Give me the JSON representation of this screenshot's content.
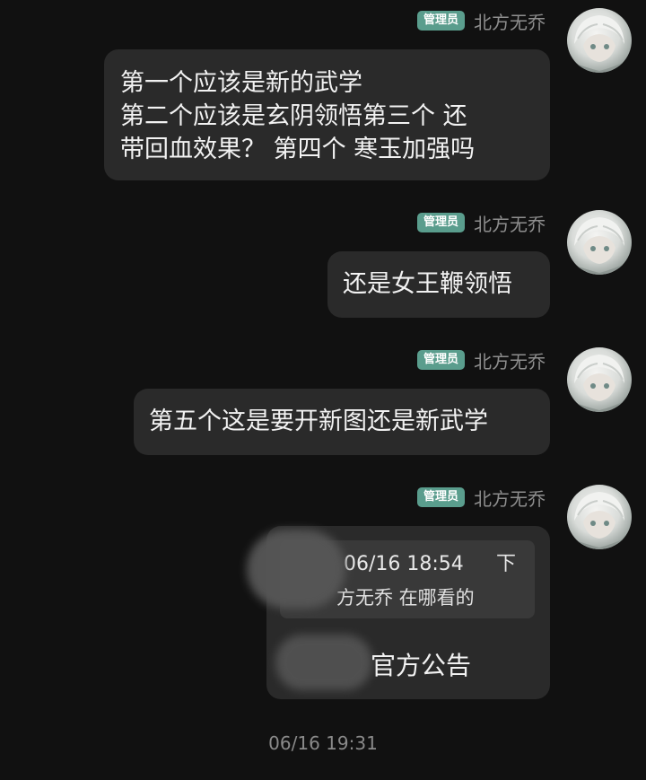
{
  "messages": [
    {
      "badge": "管理员",
      "nickname": "北方无乔",
      "lines": [
        "第一个应该是新的武学",
        "第二个应该是玄阴领悟第三个 还",
        "带回血效果？ 第四个 寒玉加强吗"
      ]
    },
    {
      "badge": "管理员",
      "nickname": "北方无乔",
      "text": "还是女王鞭领悟"
    },
    {
      "badge": "管理员",
      "nickname": "北方无乔",
      "text": "第五个这是要开新图还是新武学"
    },
    {
      "badge": "管理员",
      "nickname": "北方无乔",
      "quote": {
        "time": "06/16 18:54",
        "arrow": "下",
        "text": "方无乔 在哪看的"
      },
      "reply": "官方公告"
    }
  ],
  "time_separator": "06/16 19:31",
  "icons": {
    "avatar": "anime-avatar-icon"
  },
  "colors": {
    "background": "#111111",
    "bubble": "#2a2a2a",
    "badge": "#5a9d8d"
  }
}
